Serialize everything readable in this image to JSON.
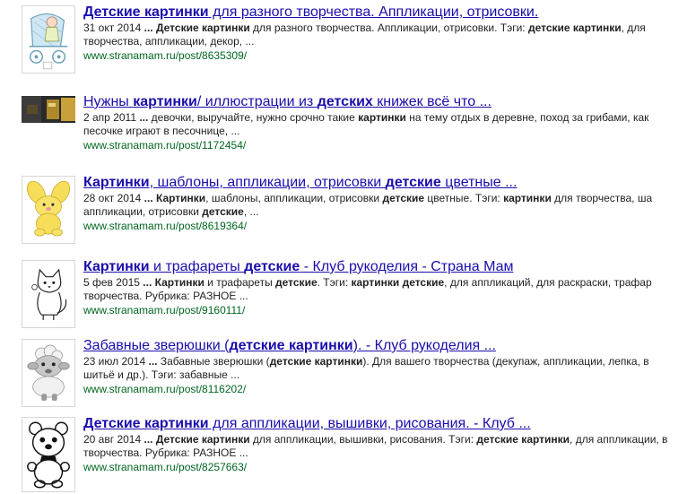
{
  "results": [
    {
      "title_parts": [
        {
          "t": "Детские картинки",
          "b": true
        },
        {
          "t": " для разного творчества. Аппликации, отрисовки.",
          "b": false
        }
      ],
      "snippet_line1": [
        {
          "t": "31 окт 2014 ",
          "b": false
        },
        {
          "t": "...",
          "b": true
        },
        {
          "t": " ",
          "b": false
        },
        {
          "t": "Детские картинки",
          "b": true
        },
        {
          "t": " для разного творчества. Аппликации, отрисовки. Тэги: ",
          "b": false
        },
        {
          "t": "детские картинки",
          "b": true
        },
        {
          "t": ", для",
          "b": false
        }
      ],
      "snippet_line2": [
        {
          "t": "творчества, аппликации, декор, ...",
          "b": false
        }
      ],
      "url": "www.stranamam.ru/post/8635309/",
      "thumb_icon": "stroller-doll-icon"
    },
    {
      "title_parts": [
        {
          "t": "Нужны ",
          "b": false
        },
        {
          "t": "картинки",
          "b": true
        },
        {
          "t": "/ иллюстрации из ",
          "b": false
        },
        {
          "t": "детских",
          "b": true
        },
        {
          "t": " книжек всё что ...",
          "b": false
        }
      ],
      "snippet_line1": [
        {
          "t": "2 апр 2011 ",
          "b": false
        },
        {
          "t": "...",
          "b": true
        },
        {
          "t": " девочки, выручайте, нужно срочно такие ",
          "b": false
        },
        {
          "t": "картинки",
          "b": true
        },
        {
          "t": " на тему отдых в деревне, поход за грибами, как",
          "b": false
        }
      ],
      "snippet_line2": [
        {
          "t": "песочке играют в песочнице, ...",
          "b": false
        }
      ],
      "url": "www.stranamam.ru/post/1172454/",
      "thumb_icon": "photo-icon"
    },
    {
      "title_parts": [
        {
          "t": "Картинки",
          "b": true
        },
        {
          "t": ", шаблоны, аппликации, отрисовки ",
          "b": false
        },
        {
          "t": "детские",
          "b": true
        },
        {
          "t": " цветные ...",
          "b": false
        }
      ],
      "snippet_line1": [
        {
          "t": "28 окт 2014 ",
          "b": false
        },
        {
          "t": "...",
          "b": true
        },
        {
          "t": " ",
          "b": false
        },
        {
          "t": "Картинки",
          "b": true
        },
        {
          "t": ", шаблоны, аппликации, отрисовки ",
          "b": false
        },
        {
          "t": "детские",
          "b": true
        },
        {
          "t": " цветные. Тэги: ",
          "b": false
        },
        {
          "t": "картинки",
          "b": true
        },
        {
          "t": " для творчества, ша",
          "b": false
        }
      ],
      "snippet_line2": [
        {
          "t": "аппликации, отрисовки ",
          "b": false
        },
        {
          "t": "детские",
          "b": true
        },
        {
          "t": ", ...",
          "b": false
        }
      ],
      "url": "www.stranamam.ru/post/8619364/",
      "thumb_icon": "yellow-bunny-icon"
    },
    {
      "title_parts": [
        {
          "t": "Картинки",
          "b": true
        },
        {
          "t": " и трафареты ",
          "b": false
        },
        {
          "t": "детские",
          "b": true
        },
        {
          "t": " - Клуб рукоделия - Страна Мам",
          "b": false
        }
      ],
      "snippet_line1": [
        {
          "t": "5 фев 2015 ",
          "b": false
        },
        {
          "t": "...",
          "b": true
        },
        {
          "t": " ",
          "b": false
        },
        {
          "t": "Картинки",
          "b": true
        },
        {
          "t": " и трафареты ",
          "b": false
        },
        {
          "t": "детские",
          "b": true
        },
        {
          "t": ". Тэги: ",
          "b": false
        },
        {
          "t": "картинки детские",
          "b": true
        },
        {
          "t": ", для аппликаций, для раскраски, трафар",
          "b": false
        }
      ],
      "snippet_line2": [
        {
          "t": "творчества. Рубрика: РАЗНОЕ ...",
          "b": false
        }
      ],
      "url": "www.stranamam.ru/post/9160111/",
      "thumb_icon": "cat-outline-icon"
    },
    {
      "title_parts": [
        {
          "t": "Забавные зверюшки (",
          "b": false
        },
        {
          "t": "детские картинки",
          "b": true
        },
        {
          "t": "). - Клуб рукоделия ...",
          "b": false
        }
      ],
      "snippet_line1": [
        {
          "t": "23 июл 2014 ",
          "b": false
        },
        {
          "t": "...",
          "b": true
        },
        {
          "t": " Забавные зверюшки (",
          "b": false
        },
        {
          "t": "детские картинки",
          "b": true
        },
        {
          "t": "). Для вашего творчества (декупаж, аппликации, лепка, в",
          "b": false
        }
      ],
      "snippet_line2": [
        {
          "t": "шитьё и др.). Тэги: забавные ...",
          "b": false
        }
      ],
      "url": "www.stranamam.ru/post/8116202/",
      "thumb_icon": "sheep-icon"
    },
    {
      "title_parts": [
        {
          "t": "Детские картинки",
          "b": true
        },
        {
          "t": " для аппликации, вышивки, рисования. - Клуб ...",
          "b": false
        }
      ],
      "snippet_line1": [
        {
          "t": "20 авг 2014 ",
          "b": false
        },
        {
          "t": "...",
          "b": true
        },
        {
          "t": " ",
          "b": false
        },
        {
          "t": "Детские картинки",
          "b": true
        },
        {
          "t": " для аппликации, вышивки, рисования. Тэги: ",
          "b": false
        },
        {
          "t": "детские картинки",
          "b": true
        },
        {
          "t": ", для аппликации, в",
          "b": false
        }
      ],
      "snippet_line2": [
        {
          "t": "творчества. Рубрика: РАЗНОЕ ...",
          "b": false
        }
      ],
      "url": "www.stranamam.ru/post/8257663/",
      "thumb_icon": "bear-outline-icon"
    }
  ]
}
